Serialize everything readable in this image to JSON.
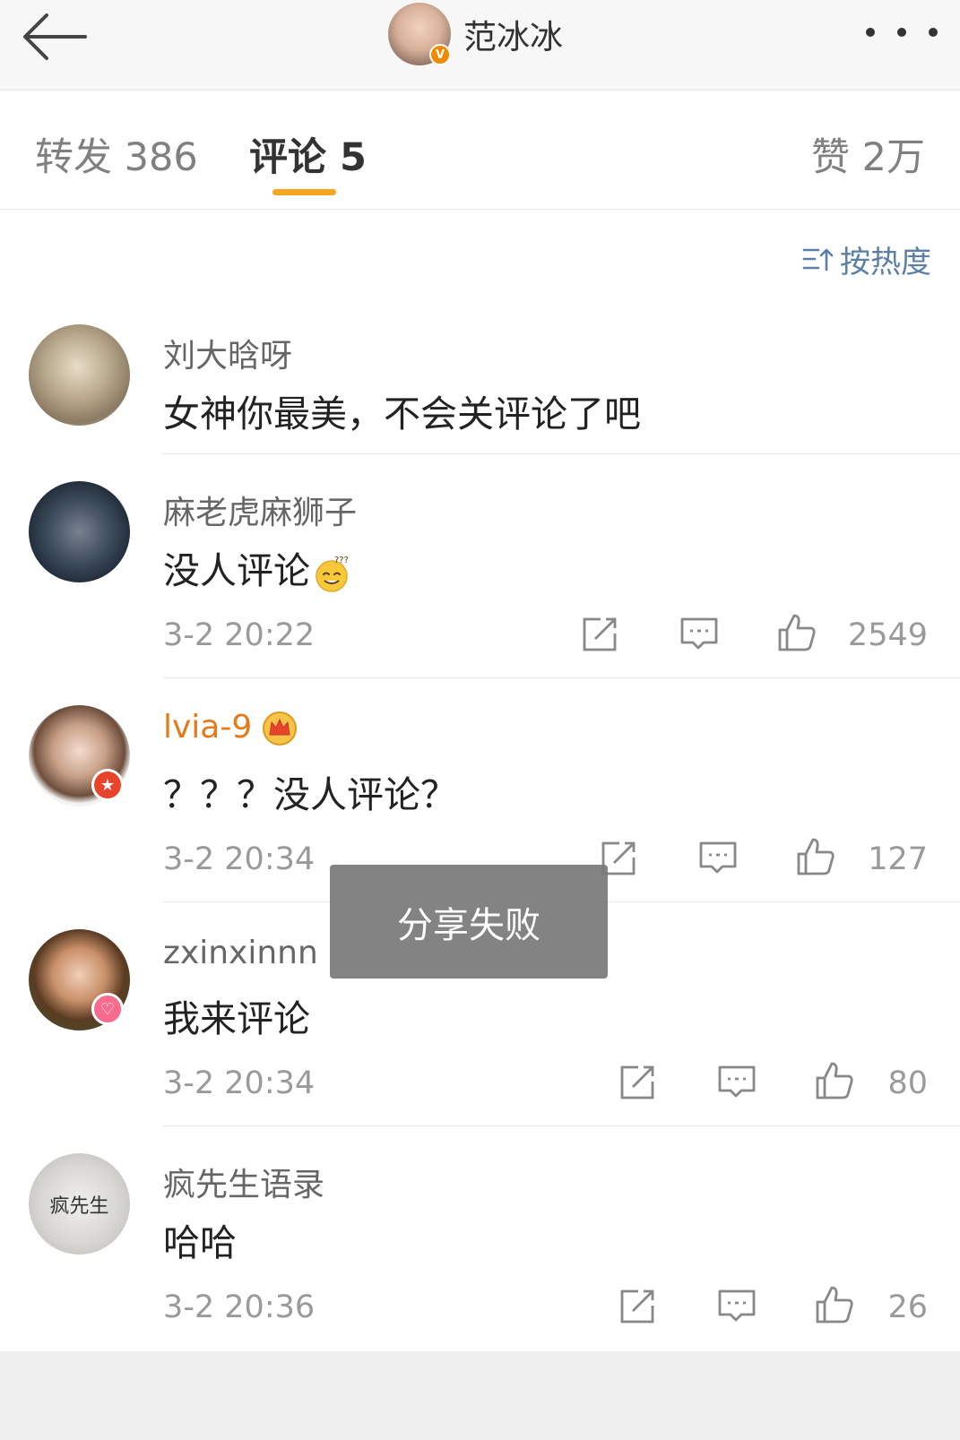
{
  "header": {
    "title": "范冰冰",
    "verified_badge": "V",
    "back_icon": "arrow-left-icon",
    "more_icon": "more-dots-icon"
  },
  "tabs": {
    "repost": "转发 386",
    "comments": "评论 5",
    "likes": "赞 2万",
    "active": "comments",
    "accent_color": "#f5a623"
  },
  "sort": {
    "label": "按热度",
    "icon": "sort-icon"
  },
  "comments": [
    {
      "username": "刘大晗呀",
      "text": "女神你最美，不会关评论了吧"
    },
    {
      "username": "麻老虎麻狮子",
      "text": "没人评论",
      "time": "3-2 20:22",
      "likes": "2549"
    },
    {
      "username": "lvia-9",
      "text": "？？？没人评论？",
      "time": "3-2 20:34",
      "likes": "127",
      "username_color": "#e77a18"
    },
    {
      "username": "zxinxinnn",
      "text": "我来评论",
      "time": "3-2 20:34",
      "likes": "80"
    },
    {
      "username": "疯先生语录",
      "text": "哈哈",
      "time": "3-2 20:36",
      "likes": "26",
      "avatar_text": "疯先生"
    }
  ],
  "toast": {
    "message": "分享失败"
  }
}
